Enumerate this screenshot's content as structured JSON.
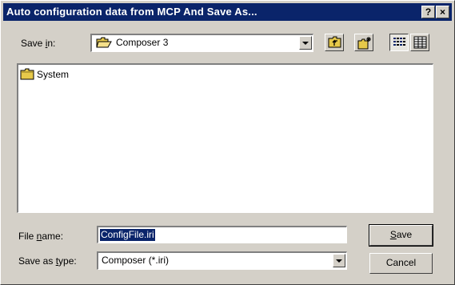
{
  "dialog": {
    "title": "Auto configuration data from MCP And Save As...",
    "help_label": "?",
    "close_label": "×"
  },
  "save_in": {
    "label_pre": "Save ",
    "label_key": "i",
    "label_post": "n:",
    "value": "Composer 3",
    "icon": "folder-open-icon"
  },
  "toolbar": {
    "up_folder_icon": "up-one-level-icon",
    "new_folder_icon": "new-folder-icon",
    "list_view_icon": "list-view-icon",
    "details_view_icon": "details-view-icon"
  },
  "file_list": {
    "items": [
      {
        "name": "System",
        "icon": "folder-icon"
      }
    ]
  },
  "file_name": {
    "label_pre": "File ",
    "label_key": "n",
    "label_post": "ame:",
    "value": "ConfigFile.iri"
  },
  "save_type": {
    "label_pre": "Save as ",
    "label_key": "t",
    "label_post": "ype:",
    "value": "Composer (*.iri)"
  },
  "buttons": {
    "save_key": "S",
    "save_rest": "ave",
    "cancel": "Cancel"
  },
  "colors": {
    "titlebar": "#0a246a",
    "face": "#d4d0c8",
    "selection": "#0a246a"
  }
}
